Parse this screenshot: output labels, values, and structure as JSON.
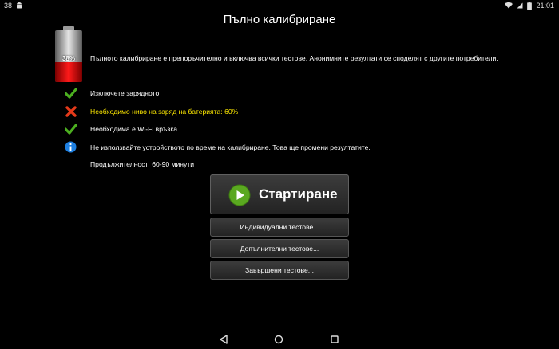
{
  "statusbar": {
    "notif_count": "38",
    "time": "21:01"
  },
  "title": "Пълно калибриране",
  "battery": {
    "percent_label": "38%",
    "level": 0.38
  },
  "intro": "Пълното калибриране е препоръчително и включва всички тестове. Анонимните резултати се споделят с другите потребители.",
  "checks": [
    {
      "icon": "green-check-icon",
      "text": "Изключете зарядното"
    },
    {
      "icon": "red-x-icon",
      "text": "Необходимо ниво на заряд на батерията: 60%"
    },
    {
      "icon": "green-check-icon",
      "text": "Необходима е Wi-Fi връзка"
    },
    {
      "icon": "info-icon",
      "text": "Не използвайте устройството по време на калибриране. Това ще промени резултатите."
    }
  ],
  "duration": "Продължителност: 60-90 минути",
  "buttons": {
    "start": "Стартиране",
    "individual": "Индивидуални тестове...",
    "additional": "Допълнителни тестове...",
    "completed": "Завършени тестове..."
  },
  "colors": {
    "warning": "#ffea00",
    "battery_fill": "#ff1a1a",
    "check_green": "#4caf20",
    "x_red": "#e53a1a",
    "info_blue": "#1e7fe0"
  }
}
